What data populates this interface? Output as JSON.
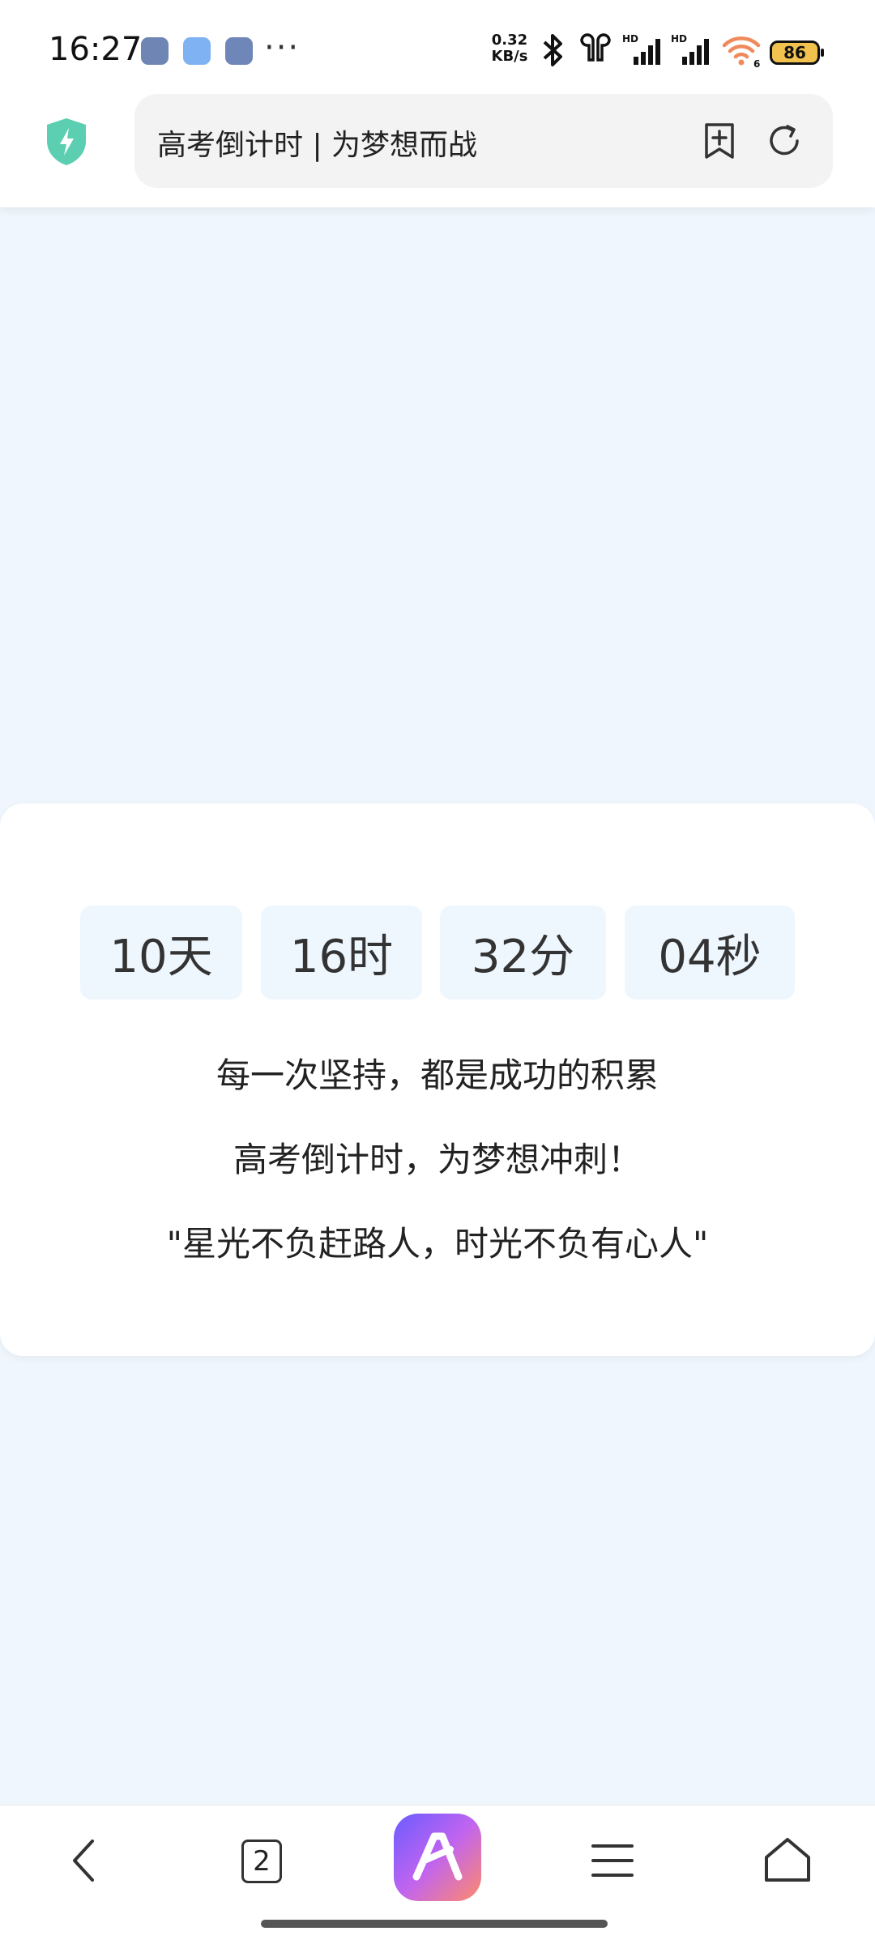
{
  "status_bar": {
    "time": "16:27",
    "dots": "···",
    "net_speed_value": "0.32",
    "net_speed_unit": "KB/s",
    "battery": "86"
  },
  "browser": {
    "page_title": "高考倒计时 | 为梦想而战"
  },
  "countdown": {
    "days": "10天",
    "hours": "16时",
    "minutes": "32分",
    "seconds": "04秒"
  },
  "messages": {
    "line1": "每一次坚持，都是成功的积累",
    "line2": "高考倒计时，为梦想冲刺！",
    "quote": "\"星光不负赶路人，时光不负有心人\""
  },
  "bottom_nav": {
    "tab_count": "2"
  },
  "colors": {
    "page_background": "#eff6fd",
    "countdown_box": "#eef6fe",
    "shield": "#5ccfb2"
  }
}
